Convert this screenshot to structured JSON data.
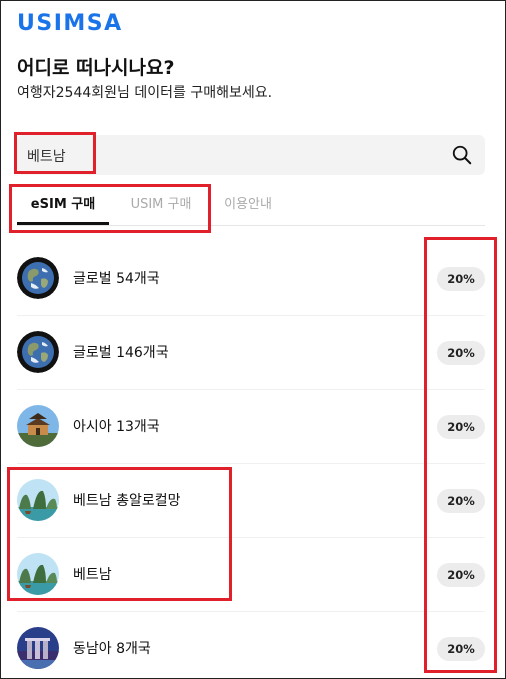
{
  "brand": {
    "logo_text": "USIMSA",
    "accent": "#1a73e8"
  },
  "header": {
    "title": "어디로 떠나시나요?",
    "subtitle": "여행자2544회원님 데이터를 구매해보세요."
  },
  "search": {
    "value": "베트남",
    "icon": "search-icon"
  },
  "tabs": [
    {
      "label": "eSIM 구매",
      "active": true
    },
    {
      "label": "USIM 구매",
      "active": false
    },
    {
      "label": "이용안내",
      "active": false
    }
  ],
  "products": [
    {
      "label": "글로벌 54개국",
      "discount": "20%",
      "icon": "globe"
    },
    {
      "label": "글로벌 146개국",
      "discount": "20%",
      "icon": "globe"
    },
    {
      "label": "아시아 13개국",
      "discount": "20%",
      "icon": "temple"
    },
    {
      "label": "베트남 총알로컬망",
      "discount": "20%",
      "icon": "halong-bay"
    },
    {
      "label": "베트남",
      "discount": "20%",
      "icon": "halong-bay"
    },
    {
      "label": "동남아 8개국",
      "discount": "20%",
      "icon": "marina-bay"
    }
  ],
  "highlight_color": "#e0202a"
}
